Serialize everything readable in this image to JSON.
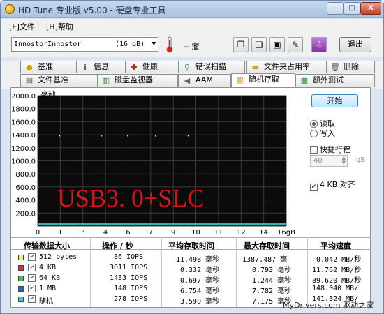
{
  "window": {
    "title": "HD Tune 专业版 v5.00 - 硬盘专业工具",
    "min": "—",
    "max": "□",
    "close": "X"
  },
  "menu": {
    "file": "[F]文件",
    "help": "[H]帮助"
  },
  "toolbar": {
    "drive": "InnostorInnostor",
    "drive_size": "(16 gB)",
    "temp": "-- 瘤",
    "exit": "退出"
  },
  "tabs_top": [
    "基准",
    "信息",
    "健康",
    "错误扫描",
    "文件夹占用率",
    "删除"
  ],
  "tabs_bottom": [
    "文件基准",
    "磁盘监视器",
    "AAM",
    "随机存取",
    "额外测试"
  ],
  "panel": {
    "start": "开始",
    "read": "读取",
    "write": "写入",
    "quick": "快捷行程",
    "quick_value": "40",
    "quick_unit": "gB",
    "align": "4 KB 对齐"
  },
  "chart_data": {
    "type": "scatter",
    "overlay_text": "USB3. 0+SLC",
    "ylabel": "毫秒",
    "yticks": [
      "2000.0",
      "1800.0",
      "1600.0",
      "1400.0",
      "1200.0",
      "1000.0",
      "800.0",
      "600.0",
      "400.0",
      "200.0",
      ""
    ],
    "xticks": [
      "0",
      "1",
      "3",
      "4",
      "6",
      "7",
      "9",
      "10",
      "11",
      "12",
      "14",
      "16gB"
    ],
    "ylim": [
      0,
      2000
    ],
    "xlim": [
      0,
      16
    ],
    "series": [
      {
        "name": "512 bytes",
        "color": "#f5f06b",
        "points": [
          [
            1.4,
            1387
          ],
          [
            4.1,
            1385
          ],
          [
            5.8,
            1386
          ],
          [
            7.6,
            1384
          ],
          [
            9.7,
            1386
          ]
        ]
      },
      {
        "name": "4 KB",
        "color": "#e03030",
        "points": []
      },
      {
        "name": "64 KB",
        "color": "#37c84a",
        "points": []
      },
      {
        "name": "1 MB",
        "color": "#2b5ecf",
        "points": []
      },
      {
        "name": "随机",
        "color": "#37d0d0",
        "points": []
      }
    ]
  },
  "table": {
    "headers": [
      "传输数据大小",
      "操作 / 秒",
      "平均存取时间",
      "最大存取时间",
      "平均速度"
    ],
    "rows": [
      {
        "label": "512 bytes",
        "ops": "86 IOPS",
        "avg": "11.498 毫秒",
        "max": "1387.487 毫",
        "speed": "0.042 MB/秒",
        "color": "#f5f06b"
      },
      {
        "label": "4 KB",
        "ops": "3011 IOPS",
        "avg": "0.332 毫秒",
        "max": "0.793 毫秒",
        "speed": "11.762 MB/秒",
        "color": "#e03030"
      },
      {
        "label": "64 KB",
        "ops": "1433 IOPS",
        "avg": "0.697 毫秒",
        "max": "1.244 毫秒",
        "speed": "89.620 MB/秒",
        "color": "#37c84a"
      },
      {
        "label": "1 MB",
        "ops": "148 IOPS",
        "avg": "6.754 毫秒",
        "max": "7.782 毫秒",
        "speed": "148.040 MB/",
        "color": "#2b5ecf"
      },
      {
        "label": "随机",
        "ops": "278 IOPS",
        "avg": "3.590 毫秒",
        "max": "7.175 毫秒",
        "speed": "141.324 MB/",
        "color": "#37d0d0"
      }
    ]
  },
  "watermark": "MyDrivers.com 驱动之家"
}
